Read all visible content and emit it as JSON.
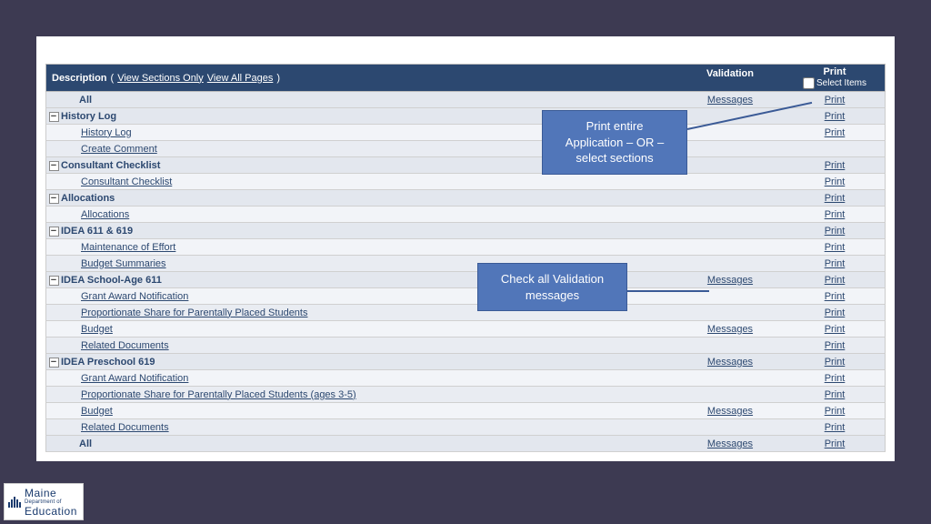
{
  "header": {
    "description": "Description",
    "view_sections": "View Sections Only",
    "view_pages": "View All Pages",
    "validation": "Validation",
    "print": "Print",
    "select_items": "Select Items"
  },
  "links": {
    "messages": "Messages",
    "print": "Print"
  },
  "toggle_glyph": "−",
  "rows": [
    {
      "type": "allrow",
      "label_key": "labels.all",
      "messages": true,
      "print": true
    },
    {
      "type": "section",
      "label_key": "labels.history_log",
      "print": true
    },
    {
      "type": "child",
      "label_key": "labels.history_log_item",
      "print": true
    },
    {
      "type": "child",
      "alt": true,
      "label_key": "labels.create_comment",
      "print": false
    },
    {
      "type": "section",
      "label_key": "labels.consultant_checklist",
      "print": true
    },
    {
      "type": "child",
      "label_key": "labels.consultant_checklist_item",
      "print": true
    },
    {
      "type": "section",
      "label_key": "labels.allocations",
      "print": true
    },
    {
      "type": "child",
      "label_key": "labels.allocations_item",
      "print": true
    },
    {
      "type": "section",
      "label_key": "labels.idea_611_619",
      "print": true
    },
    {
      "type": "child",
      "label_key": "labels.maintenance_of_effort",
      "print": true
    },
    {
      "type": "child",
      "alt": true,
      "label_key": "labels.budget_summaries",
      "print": true
    },
    {
      "type": "section",
      "label_key": "labels.idea_school_age_611",
      "messages": true,
      "print": true
    },
    {
      "type": "child",
      "label_key": "labels.grant_award_notification",
      "print": true
    },
    {
      "type": "child",
      "alt": true,
      "label_key": "labels.prop_share_parent",
      "print": true
    },
    {
      "type": "child",
      "label_key": "labels.budget",
      "messages": true,
      "print": true
    },
    {
      "type": "child",
      "alt": true,
      "label_key": "labels.related_documents",
      "print": true
    },
    {
      "type": "section",
      "label_key": "labels.idea_preschool_619",
      "messages": true,
      "print": true
    },
    {
      "type": "child",
      "label_key": "labels.grant_award_notification2",
      "print": true
    },
    {
      "type": "child",
      "alt": true,
      "label_key": "labels.prop_share_parent_35",
      "print": true
    },
    {
      "type": "child",
      "label_key": "labels.budget2",
      "messages": true,
      "print": true
    },
    {
      "type": "child",
      "alt": true,
      "label_key": "labels.related_documents2",
      "print": true
    },
    {
      "type": "allrow",
      "label_key": "labels.all2",
      "messages": true,
      "print": true
    }
  ],
  "labels": {
    "all": "All",
    "history_log": "History Log",
    "history_log_item": "History Log",
    "create_comment": "Create Comment",
    "consultant_checklist": "Consultant Checklist",
    "consultant_checklist_item": "Consultant Checklist",
    "allocations": "Allocations",
    "allocations_item": "Allocations",
    "idea_611_619": "IDEA 611 & 619",
    "maintenance_of_effort": "Maintenance of Effort",
    "budget_summaries": "Budget Summaries",
    "idea_school_age_611": "IDEA School-Age 611",
    "grant_award_notification": "Grant Award Notification",
    "prop_share_parent": "Proportionate Share for Parentally Placed Students",
    "budget": "Budget",
    "related_documents": "Related Documents",
    "idea_preschool_619": "IDEA Preschool 619",
    "grant_award_notification2": "Grant Award Notification",
    "prop_share_parent_35": "Proportionate Share for Parentally Placed Students (ages 3-5)",
    "budget2": "Budget",
    "related_documents2": "Related Documents",
    "all2": "All"
  },
  "callouts": {
    "print_tip": "Print entire Application – OR – select sections",
    "validation_tip": "Check all Validation messages"
  },
  "logo": {
    "line1": "Maine",
    "line2": "Department of",
    "line3": "Education"
  }
}
